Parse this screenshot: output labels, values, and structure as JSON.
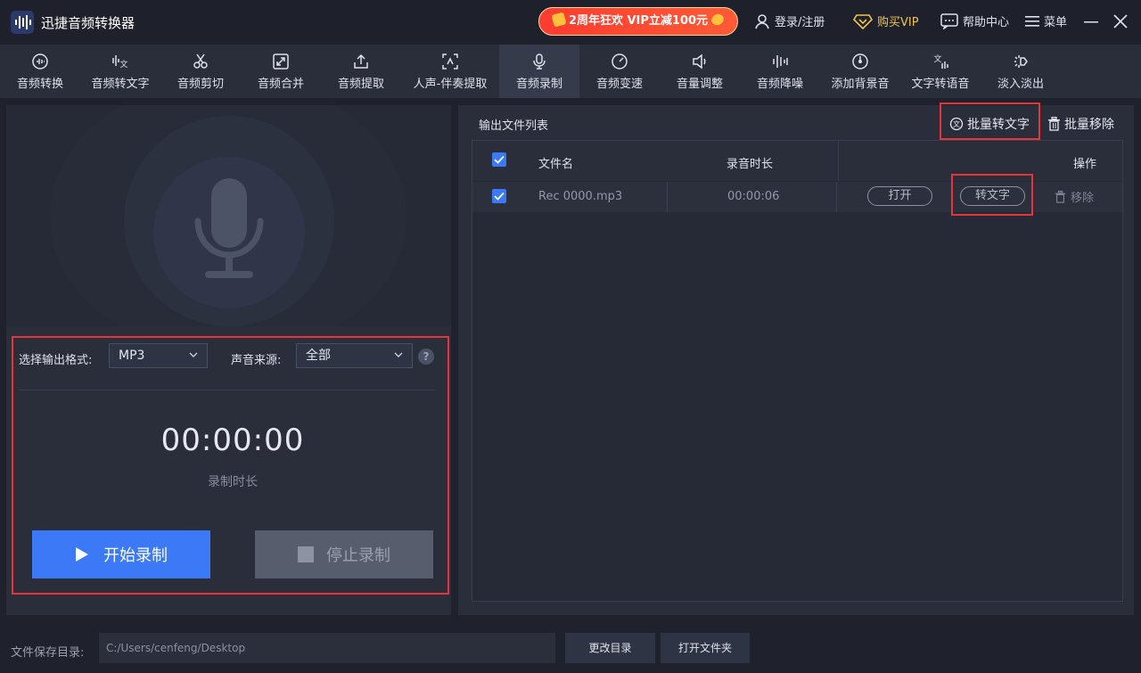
{
  "app": {
    "title": "迅捷音频转换器"
  },
  "header": {
    "promo_label": "2周年狂欢 VIP立减100元",
    "login_label": "登录/注册",
    "vip_label": "购买VIP",
    "help_label": "帮助中心",
    "menu_label": "菜单"
  },
  "toolbar": {
    "tools": [
      {
        "label": "音频转换",
        "icon": "audio-convert-icon"
      },
      {
        "label": "音频转文字",
        "icon": "audio-to-text-icon"
      },
      {
        "label": "音频剪切",
        "icon": "scissors-icon"
      },
      {
        "label": "音频合并",
        "icon": "merge-icon"
      },
      {
        "label": "音频提取",
        "icon": "upload-icon"
      },
      {
        "label": "人声-伴奏提取",
        "icon": "vocal-extract-icon"
      },
      {
        "label": "音频录制",
        "icon": "microphone-icon",
        "active": true
      },
      {
        "label": "音频变速",
        "icon": "speed-icon"
      },
      {
        "label": "音量调整",
        "icon": "speaker-icon"
      },
      {
        "label": "音频降噪",
        "icon": "waveform-icon"
      },
      {
        "label": "添加背景音",
        "icon": "disc-icon"
      },
      {
        "label": "文字转语音",
        "icon": "text-to-speech-icon"
      },
      {
        "label": "淡入淡出",
        "icon": "fade-icon"
      }
    ]
  },
  "recorder": {
    "format_label": "选择输出格式:",
    "format_value": "MP3",
    "source_label": "声音来源:",
    "source_value": "全部",
    "timer": "00:00:00",
    "timer_label": "录制时长",
    "start_label": "开始录制",
    "stop_label": "停止录制"
  },
  "output": {
    "title": "输出文件列表",
    "batch_to_text": "批量转文字",
    "batch_remove": "批量移除",
    "columns": {
      "name": "文件名",
      "duration": "录音时长",
      "actions": "操作"
    },
    "rows": [
      {
        "name": "Rec 0000.mp3",
        "duration": "00:00:06",
        "open": "打开",
        "to_text": "转文字",
        "remove": "移除",
        "checked": true
      }
    ]
  },
  "footer": {
    "save_dir_label": "文件保存目录:",
    "path": "C:/Users/cenfeng/Desktop",
    "change_dir": "更改目录",
    "open_folder": "打开文件夹"
  },
  "colors": {
    "accent": "#3b79f7",
    "highlight_border": "#e6343b",
    "vip": "#f2c34a",
    "promo": "#ff3b2f"
  }
}
